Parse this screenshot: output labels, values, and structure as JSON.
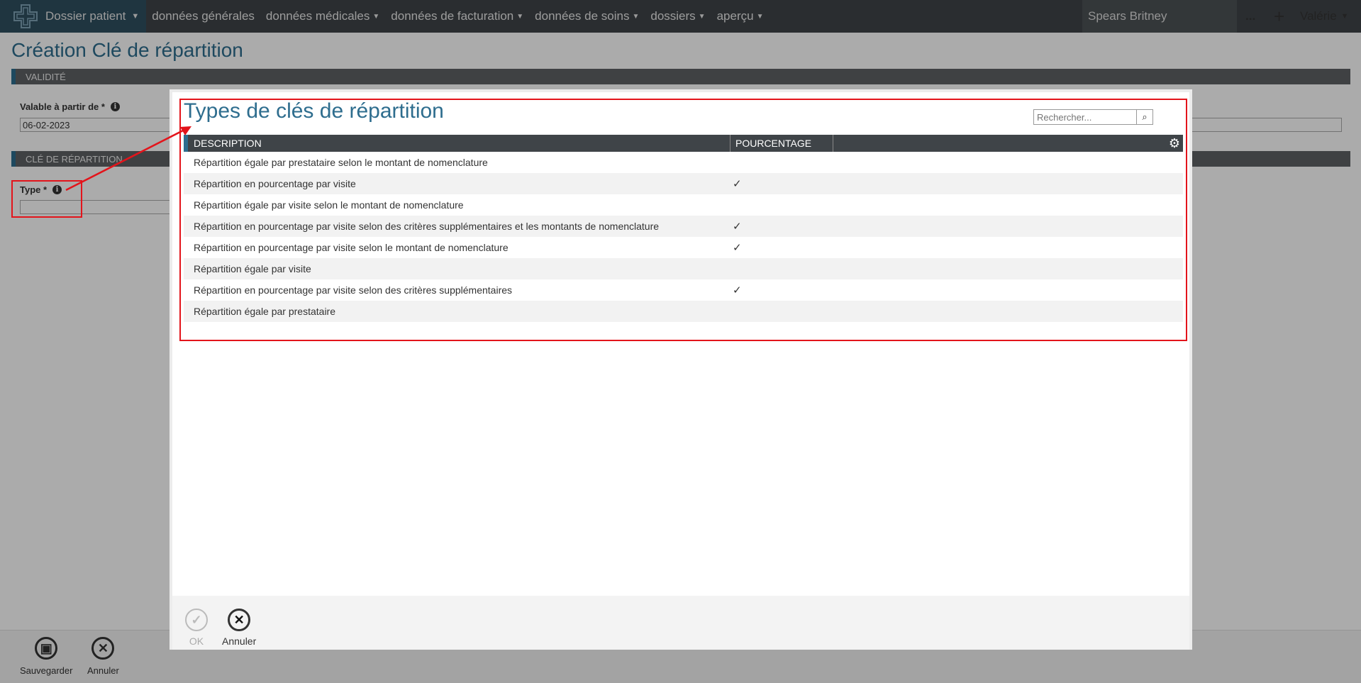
{
  "nav": {
    "brand_label": "Dossier patient",
    "items": [
      {
        "label": "données générales",
        "has_caret": false
      },
      {
        "label": "données médicales",
        "has_caret": true
      },
      {
        "label": "données de facturation",
        "has_caret": true
      },
      {
        "label": "données de soins",
        "has_caret": true
      },
      {
        "label": "dossiers",
        "has_caret": true
      },
      {
        "label": "aperçu",
        "has_caret": true
      }
    ],
    "patient_name": "Spears Britney",
    "more_label": "...",
    "user": "Valérie"
  },
  "page": {
    "title": "Création Clé de répartition",
    "sections": {
      "validity": "VALIDITÉ",
      "key": "CLÉ DE RÉPARTITION"
    },
    "valid_from_label": "Valable à partir de *",
    "valid_from_value": "06-02-2023",
    "type_label": "Type *",
    "type_value": "",
    "footer": {
      "save_label": "Sauvegarder",
      "cancel_label": "Annuler"
    }
  },
  "modal": {
    "title": "Types de clés de répartition",
    "search_placeholder": "Rechercher...",
    "columns": {
      "description": "DESCRIPTION",
      "percentage": "POURCENTAGE"
    },
    "rows": [
      {
        "description": "Répartition égale par prestataire selon le montant de nomenclature",
        "percentage": ""
      },
      {
        "description": "Répartition en pourcentage par visite",
        "percentage": "✓"
      },
      {
        "description": "Répartition égale par visite selon le montant de nomenclature",
        "percentage": ""
      },
      {
        "description": "Répartition en pourcentage par visite selon des critères supplémentaires et les montants de nomenclature",
        "percentage": "✓"
      },
      {
        "description": "Répartition en pourcentage par visite selon le montant de nomenclature",
        "percentage": "✓"
      },
      {
        "description": "Répartition égale par visite",
        "percentage": ""
      },
      {
        "description": "Répartition en pourcentage par visite selon des critères supplémentaires",
        "percentage": "✓"
      },
      {
        "description": "Répartition égale par prestataire",
        "percentage": ""
      }
    ],
    "ok_label": "OK",
    "cancel_label": "Annuler"
  },
  "colors": {
    "accent": "#2e6d8e",
    "nav_bg": "#3f4448",
    "annotation": "#e3141b"
  }
}
